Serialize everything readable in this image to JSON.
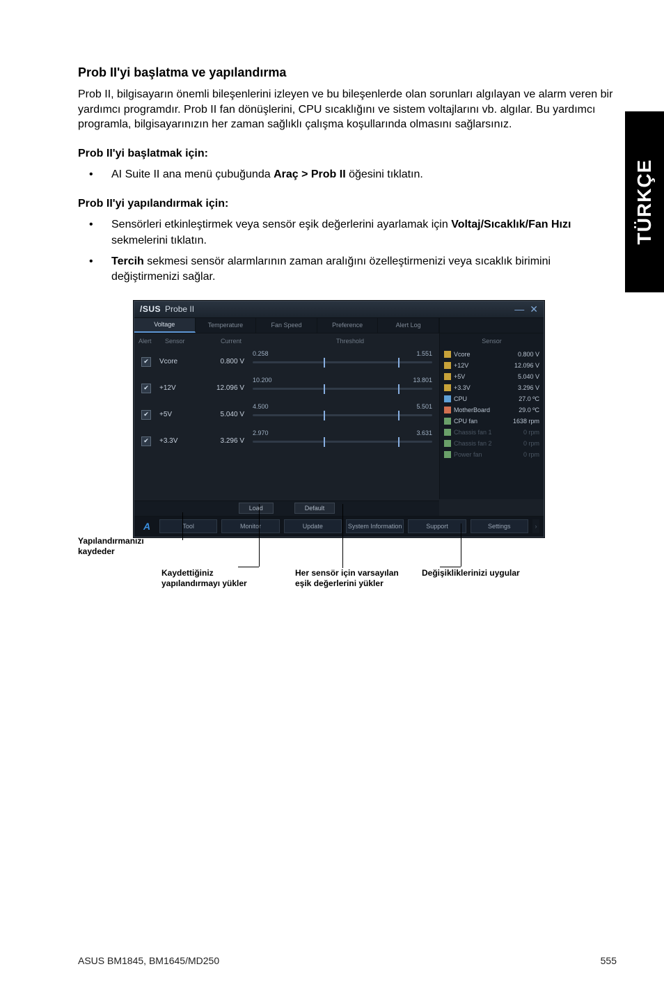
{
  "side_label": "TÜRKÇE",
  "h1": "Prob II'yi başlatma ve yapılandırma",
  "intro": "Prob II, bilgisayarın önemli bileşenlerini izleyen ve bu bileşenlerde olan sorunları algılayan ve alarm veren bir yardımcı programdır.  Prob II fan dönüşlerini, CPU sıcaklığını ve sistem voltajlarını vb. algılar.  Bu yardımcı programla, bilgisayarınızın her zaman sağlıklı çalışma koşullarında olmasını sağlarsınız.",
  "start_head": "Prob II'yi başlatmak için:",
  "start_item_pre": "AI Suite II ana menü çubuğunda ",
  "start_item_bold": "Araç > Prob II",
  "start_item_post": " öğesini tıklatın.",
  "conf_head": "Prob II'yi yapılandırmak için:",
  "conf_item1_pre": "Sensörleri etkinleştirmek veya sensör eşik değerlerini ayarlamak için ",
  "conf_item1_bold": "Voltaj/Sıcaklık/Fan Hızı",
  "conf_item1_post": " sekmelerini tıklatın.",
  "conf_item2_bold": "Tercih",
  "conf_item2_post": " sekmesi sensör alarmlarının zaman aralığını özelleştirmenizi veya sıcaklık birimini değiştirmenizi sağlar.",
  "app": {
    "brand": "/SUS",
    "title": "Probe II",
    "tabs": [
      "Voltage",
      "Temperature",
      "Fan Speed",
      "Preference",
      "Alert Log"
    ],
    "left_headers": [
      "Alert",
      "Sensor",
      "Current",
      "Threshold"
    ],
    "rows": [
      {
        "name": "Vcore",
        "current": "0.800 V",
        "lo": "0.258",
        "hi": "1.551"
      },
      {
        "name": "+12V",
        "current": "12.096 V",
        "lo": "10.200",
        "hi": "13.801"
      },
      {
        "name": "+5V",
        "current": "5.040 V",
        "lo": "4.500",
        "hi": "5.501"
      },
      {
        "name": "+3.3V",
        "current": "3.296 V",
        "lo": "2.970",
        "hi": "3.631"
      }
    ],
    "mid_buttons": [
      "Load",
      "Default"
    ],
    "right_header": "Sensor",
    "right_items": [
      {
        "icon": "bolt",
        "label": "Vcore",
        "value": "0.800 V",
        "dim": false
      },
      {
        "icon": "bolt",
        "label": "+12V",
        "value": "12.096 V",
        "dim": false
      },
      {
        "icon": "bolt",
        "label": "+5V",
        "value": "5.040 V",
        "dim": false
      },
      {
        "icon": "bolt",
        "label": "+3.3V",
        "value": "3.296 V",
        "dim": false
      },
      {
        "icon": "chip",
        "label": "CPU",
        "value": "27.0 ºC",
        "dim": false
      },
      {
        "icon": "therm",
        "label": "MotherBoard",
        "value": "29.0 ºC",
        "dim": false
      },
      {
        "icon": "fan",
        "label": "CPU fan",
        "value": "1638 rpm",
        "dim": false
      },
      {
        "icon": "fan",
        "label": "Chassis fan 1",
        "value": "0 rpm",
        "dim": true
      },
      {
        "icon": "fan",
        "label": "Chassis fan 2",
        "value": "0 rpm",
        "dim": true
      },
      {
        "icon": "fan",
        "label": "Power fan",
        "value": "0 rpm",
        "dim": true
      }
    ],
    "bottom_buttons": [
      "Tool",
      "Monitor",
      "Update",
      "System Information",
      "Support",
      "Settings"
    ]
  },
  "callouts": {
    "save": "Yapılandırmanızı kaydeder",
    "load": "Kaydettiğiniz yapılandırmayı yükler",
    "default": "Her sensör için varsayılan eşik değerlerini yükler",
    "apply": "Değişikliklerinizi uygular"
  },
  "footer_left": "ASUS BM1845, BM1645/MD250",
  "footer_right": "555"
}
